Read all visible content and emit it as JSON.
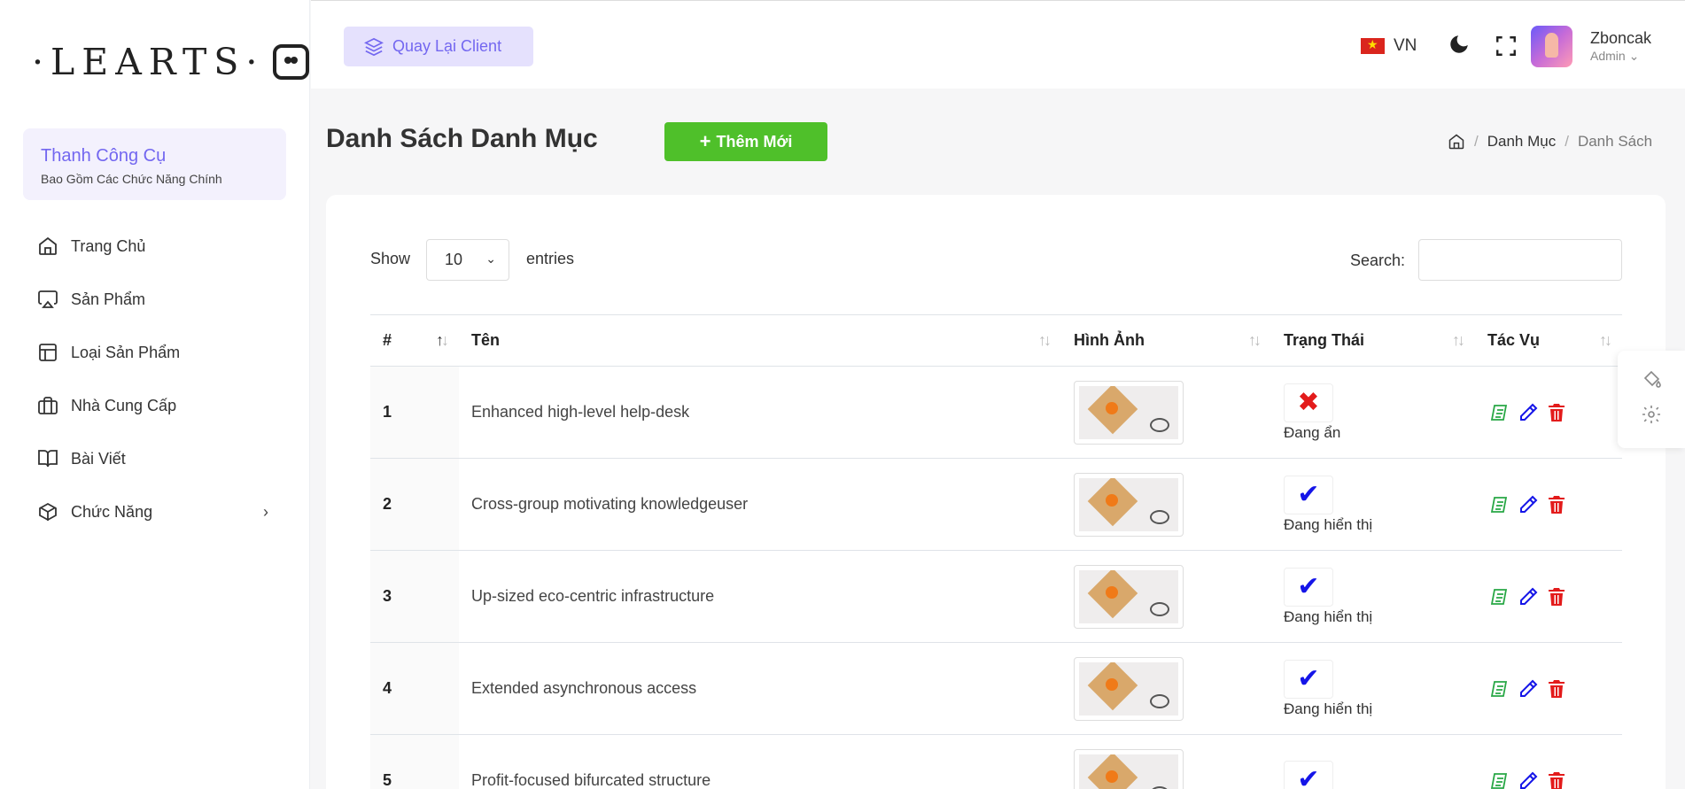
{
  "brand": {
    "logo_text": "·LEARTS·"
  },
  "sidebar": {
    "toolbar_title": "Thanh Công Cụ",
    "toolbar_subtitle": "Bao Gồm Các Chức Năng Chính",
    "items": [
      {
        "label": "Trang Chủ",
        "icon": "home-icon"
      },
      {
        "label": "Sản Phẩm",
        "icon": "airplay-icon"
      },
      {
        "label": "Loại Sản Phẩm",
        "icon": "layout-icon"
      },
      {
        "label": "Nhà Cung Cấp",
        "icon": "briefcase-icon"
      },
      {
        "label": "Bài Viết",
        "icon": "book-icon"
      },
      {
        "label": "Chức Năng",
        "icon": "box-icon"
      }
    ]
  },
  "header": {
    "back_label": "Quay Lại Client",
    "lang": "VN",
    "user_name": "Zboncak",
    "user_role": "Admin"
  },
  "page": {
    "title": "Danh Sách Danh Mục",
    "add_label": "Thêm Mới",
    "breadcrumb": [
      "Danh Mục",
      "Danh Sách"
    ]
  },
  "table_controls": {
    "show_label": "Show",
    "entries_value": "10",
    "entries_label": "entries",
    "search_label": "Search:"
  },
  "table": {
    "headers": [
      "#",
      "Tên",
      "Hình Ảnh",
      "Trạng Thái",
      "Tác Vụ"
    ],
    "rows": [
      {
        "num": "1",
        "name": "Enhanced high-level help-desk",
        "status": "Đang ẩn",
        "status_type": "hidden"
      },
      {
        "num": "2",
        "name": "Cross-group motivating knowledgeuser",
        "status": "Đang hiển thị",
        "status_type": "shown"
      },
      {
        "num": "3",
        "name": "Up-sized eco-centric infrastructure",
        "status": "Đang hiển thị",
        "status_type": "shown"
      },
      {
        "num": "4",
        "name": "Extended asynchronous access",
        "status": "Đang hiển thị",
        "status_type": "shown"
      },
      {
        "num": "5",
        "name": "Profit-focused bifurcated structure",
        "status": "",
        "status_type": "shown"
      }
    ]
  },
  "colors": {
    "primary": "#7367f0",
    "success": "#4fc02a",
    "danger": "#e31b1b",
    "info": "#1515e8",
    "view_green": "#28a745"
  }
}
